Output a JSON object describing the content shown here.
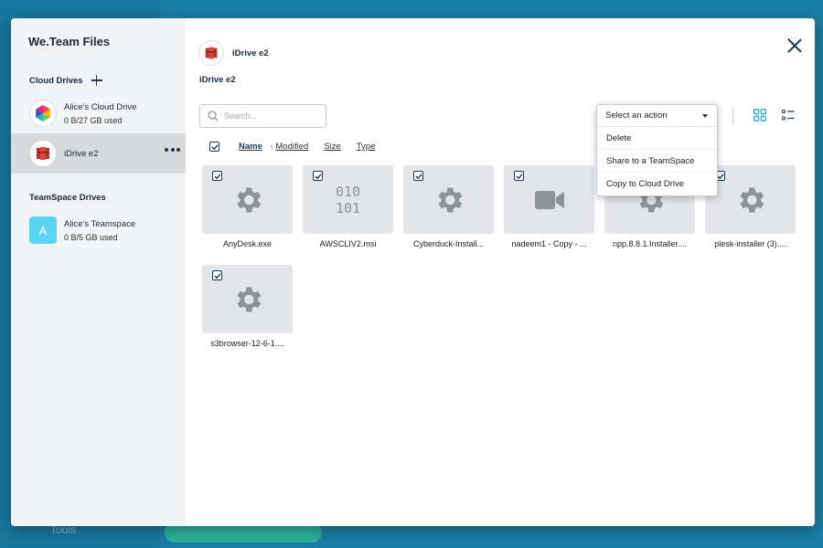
{
  "background": {
    "tools_label": "Tools"
  },
  "app": {
    "title": "We.Team Files"
  },
  "sidebar": {
    "cloud_drives_heading": "Cloud Drives",
    "cloud_drives": [
      {
        "name": "Alice's Cloud Drive",
        "usage": "0 B/27 GB used",
        "icon": "multicolor-hexagon-icon"
      },
      {
        "name": "iDrive e2",
        "usage": "",
        "icon": "idrive-e2-logo",
        "active": true
      }
    ],
    "teamspace_heading": "TeamSpace Drives",
    "teamspaces": [
      {
        "initial": "A",
        "name": "Alice's Teamspace",
        "usage": "0 B/5 GB used"
      }
    ]
  },
  "main": {
    "header_title": "iDrive e2",
    "breadcrumb": "iDrive e2",
    "search_placeholder": "Search...",
    "sort": {
      "name": "Name",
      "arrow": "↑",
      "modified": "Modified",
      "size": "Size",
      "type": "Type"
    },
    "action_menu": {
      "placeholder": "Select an action",
      "options": [
        "Delete",
        "Share to a TeamSpace",
        "Copy to Cloud Drive"
      ]
    },
    "files": [
      {
        "label": "AnyDesk.exe",
        "icon": "gear-icon",
        "checked": true
      },
      {
        "label": "AWSCLIV2.msi",
        "icon": "binary-icon",
        "checked": true
      },
      {
        "label": "Cyberduck-Install...",
        "icon": "gear-icon",
        "checked": true
      },
      {
        "label": "nadeem1 - Copy - ...",
        "icon": "video-camera-icon",
        "checked": true
      },
      {
        "label": "npp.8.8.1.Installer....",
        "icon": "gear-icon",
        "checked": true
      },
      {
        "label": "plesk-installer (3)....",
        "icon": "gear-icon",
        "checked": true
      },
      {
        "label": "s3browser-12-6-1....",
        "icon": "gear-icon",
        "checked": true
      }
    ],
    "binary_text_line1": "010",
    "binary_text_line2": "101"
  },
  "colors": {
    "accent": "#1d3a52",
    "grid_view_active": "#2aa8d8",
    "tile_bg": "#e3e5e8",
    "sidebar_bg": "#f2f3f4",
    "active_drive_bg": "#d8dadc",
    "team_avatar": "#5ad4f0"
  }
}
